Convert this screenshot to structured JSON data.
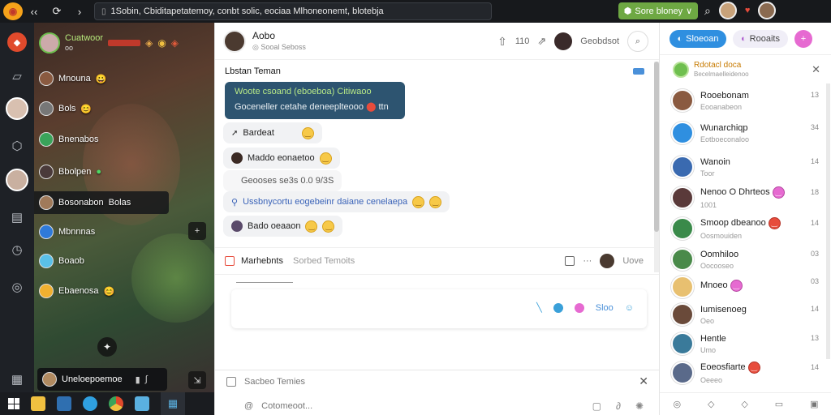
{
  "topbar": {
    "back_icon_label": "‹‹",
    "url_text": "1Sobin, Cbiditapetatemoy, conbt solic, eociaa Mlhoneonemt, blotebja",
    "green_button_label": "Sore bloney",
    "green_button_arrow": "∨"
  },
  "left_panel": {
    "header_name": "Cuatwoor",
    "header_sub": "oo",
    "contacts": [
      {
        "label": "Mnouna",
        "badge": "😀"
      },
      {
        "label": "Bols",
        "badge": "😊"
      },
      {
        "label": "Bnenabos",
        "badge": ""
      },
      {
        "label": "Bbolpen",
        "badge": ""
      },
      {
        "label": "Bosonabon",
        "badge": "Bolas"
      },
      {
        "label": "Mbnnnas",
        "badge": ""
      },
      {
        "label": "Boaob",
        "badge": ""
      },
      {
        "label": "Ebaenosa",
        "badge": "😊"
      }
    ],
    "bottom_label": "Uneloepoemoe"
  },
  "chat": {
    "contact_name": "Aobo",
    "contact_status": "◎ Sooal Seboss",
    "like_count": "110",
    "header_user": "Geobdsot",
    "section_title": "Lbstan Teman",
    "dark_bubble": {
      "line1": "Woote csoand (eboeboa) Citiwaoo",
      "line2": "Goceneller cetahe deneeplteooo",
      "line2_suffix": "ttn"
    },
    "messages": [
      {
        "text": "Bardeat",
        "emoji": "😊"
      },
      {
        "text": "Maddo eonaetoo",
        "emoji": "😊"
      },
      {
        "text": "Geooses se3s 0.0 9/3S",
        "emoji": ""
      },
      {
        "text": "Ussbnycortu eogebeinr daiane cenelaepa",
        "emoji": "😊😊"
      },
      {
        "text": "Bado oeaaon",
        "emoji": "😊😊"
      }
    ],
    "compose_title": "Marhebnts",
    "compose_subtitle": "Sorbed Temoits",
    "compose_user": "Uove",
    "send_label": "Sloo",
    "search_placeholder": "Sacbeo Temies",
    "bottom_placeholder": "Cotomeoot..."
  },
  "right_panel": {
    "button_primary": "Sloeoan",
    "button_secondary": "Rooaits",
    "header_label": "Rdotacl doca",
    "header_sub": "Becelmaelleidenoo",
    "users": [
      {
        "name": "Rooebonam",
        "sub": "Eooanabeon",
        "count": "13"
      },
      {
        "name": "Wunarchiqp",
        "sub": "Eotboeconaloo",
        "count": "34"
      },
      {
        "name": "Wanoin",
        "sub": "Toor",
        "count": "14"
      },
      {
        "name": "Nenoo O Dhrteos",
        "sub": "1001",
        "count": "18"
      },
      {
        "name": "Smoop dbeanoo",
        "sub": "Oosmouiden",
        "count": "14"
      },
      {
        "name": "Oomhiloo",
        "sub": "Oocooseo",
        "count": "03"
      },
      {
        "name": "Mnoeo",
        "sub": "",
        "count": "03"
      },
      {
        "name": "Iumisenoeg",
        "sub": "Oeo",
        "count": "14"
      },
      {
        "name": "Hentle",
        "sub": "Umo",
        "count": "13"
      },
      {
        "name": "Eoeosfiarte",
        "sub": "Oeeeo",
        "count": "14"
      }
    ],
    "bottom_icons": [
      "◎",
      "◇",
      "◇",
      "▭",
      "▣"
    ]
  },
  "taskbar": {
    "apps": [
      "file-explorer",
      "task-manager",
      "edge",
      "chrome",
      "folder",
      "grid-app"
    ]
  }
}
